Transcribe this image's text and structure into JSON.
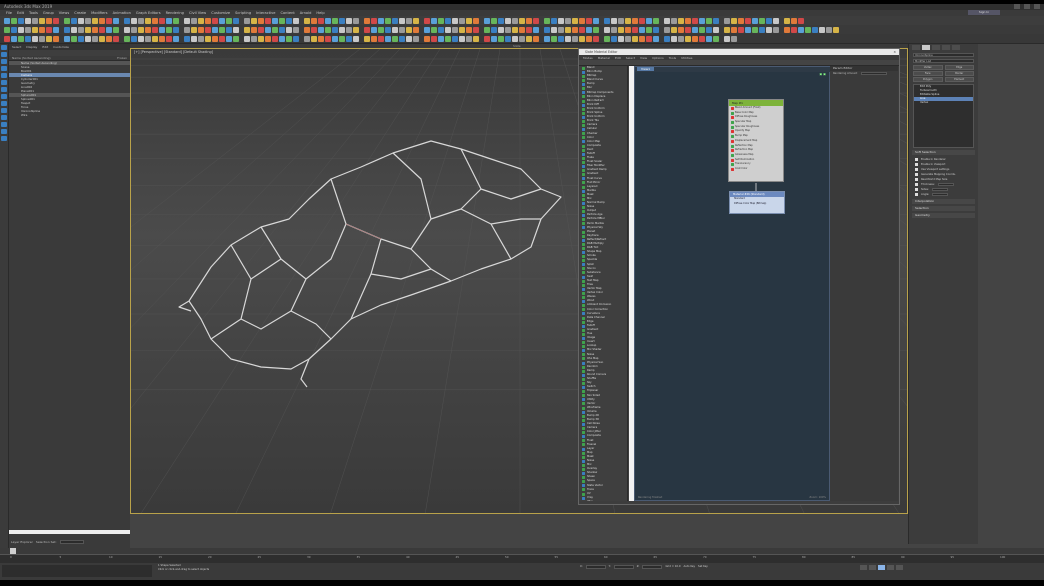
{
  "app": {
    "title": "Autodesk 3ds Max 2019",
    "signin_label": "Sign In"
  },
  "menu": [
    "File",
    "Edit",
    "Tools",
    "Group",
    "Views",
    "Create",
    "Modifiers",
    "Animation",
    "Graph Editors",
    "Rendering",
    "Civil View",
    "Customize",
    "Scripting",
    "Interactive",
    "Content",
    "Arnold",
    "Help"
  ],
  "explorer": {
    "tabs": [
      "Select",
      "Display",
      "Edit",
      "Customize"
    ],
    "columns": {
      "name": "Name (Sorted Ascending)",
      "frozen": "Frozen",
      "render": "Re"
    },
    "rows": [
      {
        "label": "Name (Sorted Ascending)",
        "style": "alt"
      },
      {
        "label": "Scene",
        "style": ""
      },
      {
        "label": "Box001",
        "style": ""
      },
      {
        "label": "Camera",
        "style": "sel"
      },
      {
        "label": "Cylinder001",
        "style": ""
      },
      {
        "label": "Geometry",
        "style": ""
      },
      {
        "label": "Line002",
        "style": ""
      },
      {
        "label": "Plane001",
        "style": ""
      },
      {
        "label": "Sphere001",
        "style": "alt"
      },
      {
        "label": "Spline001",
        "style": ""
      },
      {
        "label": "Teapot",
        "style": ""
      },
      {
        "label": "Torus",
        "style": ""
      },
      {
        "label": "VoronoiSpline",
        "style": ""
      },
      {
        "label": "Wire",
        "style": ""
      }
    ],
    "layer_label": "Layer Explorer",
    "selection_label": "Selection Set:"
  },
  "viewport": {
    "label": "[+] [Perspective] [Standard] [Default Shading]",
    "top_label": "Slate"
  },
  "slate": {
    "title": "Slate Material Editor",
    "menu": [
      "Modes",
      "Material",
      "Edit",
      "Select",
      "View",
      "Options",
      "Tools",
      "Utilities"
    ],
    "view_tab": "View1",
    "materials": [
      {
        "label": "Blend",
        "c": "#3fa34d"
      },
      {
        "label": "Blinn Bump",
        "c": "#3a7fc1"
      },
      {
        "label": "Bitmap",
        "c": "#3fa34d"
      },
      {
        "label": "Blend Curve",
        "c": "#3fa34d"
      },
      {
        "label": "Bump",
        "c": "#3a7fc1"
      },
      {
        "label": "Blur",
        "c": "#3fa34d"
      },
      {
        "label": "Bitmap Components",
        "c": "#3a7fc1"
      },
      {
        "label": "Blinn Displace",
        "c": "#3fa34d"
      },
      {
        "label": "Blinn Refract",
        "c": "#3fa34d"
      },
      {
        "label": "Brick Diff",
        "c": "#3a7fc1"
      },
      {
        "label": "Brick Uniform",
        "c": "#3fa34d"
      },
      {
        "label": "Brick Spline",
        "c": "#3fa34d"
      },
      {
        "label": "Brick Uniform",
        "c": "#3a7fc1"
      },
      {
        "label": "Brick Tile",
        "c": "#3fa34d"
      },
      {
        "label": "Camera",
        "c": "#3fa34d"
      },
      {
        "label": "Cellular",
        "c": "#3a7fc1"
      },
      {
        "label": "Checker",
        "c": "#3fa34d"
      },
      {
        "label": "Color",
        "c": "#3fa34d"
      },
      {
        "label": "Color Map",
        "c": "#3a7fc1"
      },
      {
        "label": "Composite",
        "c": "#3fa34d"
      },
      {
        "label": "Dent",
        "c": "#3fa34d"
      },
      {
        "label": "Falloff",
        "c": "#3a7fc1"
      },
      {
        "label": "Flake",
        "c": "#3fa34d"
      },
      {
        "label": "Float Scalar",
        "c": "#3fa34d"
      },
      {
        "label": "Fiber Modifier",
        "c": "#3a7fc1"
      },
      {
        "label": "Gradient Ramp",
        "c": "#3fa34d"
      },
      {
        "label": "Gradient",
        "c": "#3fa34d"
      },
      {
        "label": "Float Curve",
        "c": "#3a7fc1"
      },
      {
        "label": "Flat Mirror",
        "c": "#3fa34d"
      },
      {
        "label": "Layered",
        "c": "#3fa34d"
      },
      {
        "label": "Marble",
        "c": "#3a7fc1"
      },
      {
        "label": "Mask",
        "c": "#3fa34d"
      },
      {
        "label": "Mix",
        "c": "#3fa34d"
      },
      {
        "label": "Normal Bump",
        "c": "#3a7fc1"
      },
      {
        "label": "Noise",
        "c": "#3fa34d"
      },
      {
        "label": "Output",
        "c": "#3fa34d"
      },
      {
        "label": "Particle Age",
        "c": "#3a7fc1"
      },
      {
        "label": "Particle MBlur",
        "c": "#3fa34d"
      },
      {
        "label": "Perlin Marble",
        "c": "#3fa34d"
      },
      {
        "label": "Physical Sky",
        "c": "#3a7fc1"
      },
      {
        "label": "Planet",
        "c": "#3fa34d"
      },
      {
        "label": "Raytrace",
        "c": "#3fa34d"
      },
      {
        "label": "Reflect/Refract",
        "c": "#3a7fc1"
      },
      {
        "label": "RGB Multiply",
        "c": "#3fa34d"
      },
      {
        "label": "RGB Tint",
        "c": "#3fa34d"
      },
      {
        "label": "Shape Map",
        "c": "#3a7fc1"
      },
      {
        "label": "Smoke",
        "c": "#3fa34d"
      },
      {
        "label": "Speckle",
        "c": "#3fa34d"
      },
      {
        "label": "Splat",
        "c": "#3a7fc1"
      },
      {
        "label": "Stucco",
        "c": "#3fa34d"
      },
      {
        "label": "Substance",
        "c": "#3fa34d"
      },
      {
        "label": "Swirl",
        "c": "#3a7fc1"
      },
      {
        "label": "Text Map",
        "c": "#3fa34d"
      },
      {
        "label": "Tiles",
        "c": "#3fa34d"
      },
      {
        "label": "Vector Map",
        "c": "#3a7fc1"
      },
      {
        "label": "Vertex Color",
        "c": "#3fa34d"
      },
      {
        "label": "Waves",
        "c": "#3fa34d"
      },
      {
        "label": "Wood",
        "c": "#3a7fc1"
      },
      {
        "label": "Ambient Occlusion",
        "c": "#3fa34d"
      },
      {
        "label": "Color Correction",
        "c": "#3fa34d"
      },
      {
        "label": "Curvature",
        "c": "#3a7fc1"
      },
      {
        "label": "Data Channel",
        "c": "#3fa34d"
      },
      {
        "label": "Edge",
        "c": "#3fa34d"
      },
      {
        "label": "Falloff",
        "c": "#3a7fc1"
      },
      {
        "label": "Gradient",
        "c": "#3fa34d"
      },
      {
        "label": "Hue",
        "c": "#3fa34d"
      },
      {
        "label": "Image",
        "c": "#3a7fc1"
      },
      {
        "label": "Invert",
        "c": "#3fa34d"
      },
      {
        "label": "Lookup",
        "c": "#3fa34d"
      },
      {
        "label": "Mix Shader",
        "c": "#3a7fc1"
      },
      {
        "label": "Noise",
        "c": "#3fa34d"
      },
      {
        "label": "OSL Map",
        "c": "#3fa34d"
      },
      {
        "label": "Physical Sun",
        "c": "#3a7fc1"
      },
      {
        "label": "Random",
        "c": "#3fa34d"
      },
      {
        "label": "Ramp",
        "c": "#3fa34d"
      },
      {
        "label": "Round Corners",
        "c": "#3a7fc1"
      },
      {
        "label": "Shuffle",
        "c": "#3fa34d"
      },
      {
        "label": "Sky",
        "c": "#3fa34d"
      },
      {
        "label": "Switch",
        "c": "#3a7fc1"
      },
      {
        "label": "Triplanar",
        "c": "#3fa34d"
      },
      {
        "label": "Two Sided",
        "c": "#3fa34d"
      },
      {
        "label": "Utility",
        "c": "#3a7fc1"
      },
      {
        "label": "Vector",
        "c": "#3fa34d"
      },
      {
        "label": "Wireframe",
        "c": "#3fa34d"
      },
      {
        "label": "Volume",
        "c": "#3a7fc1"
      },
      {
        "label": "Bump 2D",
        "c": "#3fa34d"
      },
      {
        "label": "Bump 3D",
        "c": "#3fa34d"
      },
      {
        "label": "Cell Noise",
        "c": "#3a7fc1"
      },
      {
        "label": "Camera",
        "c": "#3fa34d"
      },
      {
        "label": "Color Jitter",
        "c": "#3fa34d"
      },
      {
        "label": "Composite",
        "c": "#3a7fc1"
      },
      {
        "label": "Float",
        "c": "#3fa34d"
      },
      {
        "label": "Fresnel",
        "c": "#3fa34d"
      },
      {
        "label": "Layer",
        "c": "#3a7fc1"
      },
      {
        "label": "Map",
        "c": "#3fa34d"
      },
      {
        "label": "Mask",
        "c": "#3fa34d"
      },
      {
        "label": "Noise",
        "c": "#3a7fc1"
      },
      {
        "label": "Mix",
        "c": "#3fa34d"
      },
      {
        "label": "Overlay",
        "c": "#3fa34d"
      },
      {
        "label": "Shadow",
        "c": "#3a7fc1"
      },
      {
        "label": "Sheen",
        "c": "#3fa34d"
      },
      {
        "label": "Space",
        "c": "#3fa34d"
      },
      {
        "label": "State Vector",
        "c": "#3a7fc1"
      },
      {
        "label": "Trace",
        "c": "#3fa34d"
      },
      {
        "label": "UV",
        "c": "#3fa34d"
      },
      {
        "label": "Vray",
        "c": "#3a7fc1"
      },
      {
        "label": "Wire",
        "c": "#3fa34d"
      }
    ],
    "node": {
      "title": "Map #1",
      "slots": [
        {
          "label": "Blend Amount (Float)",
          "c": "#d33"
        },
        {
          "label": "Base Color Map",
          "c": "#3fa34d"
        },
        {
          "label": "Diffuse Roughness",
          "c": "#d33"
        },
        {
          "label": "Specular Map",
          "c": "#3fa34d"
        },
        {
          "label": "Specular Roughness",
          "c": "#3fa34d"
        },
        {
          "label": "Opacity Map",
          "c": "#d33"
        },
        {
          "label": "Bump Map",
          "c": "#3fa34d"
        },
        {
          "label": "Displacement Map",
          "c": "#d33"
        },
        {
          "label": "Reflection Map",
          "c": "#3fa34d"
        },
        {
          "label": "Refraction Map",
          "c": "#d33"
        },
        {
          "label": "Glossiness Map",
          "c": "#3fa34d"
        },
        {
          "label": "Self-Illumination",
          "c": "#d33"
        },
        {
          "label": "Translucency",
          "c": "#3fa34d"
        },
        {
          "label": "Coat Color",
          "c": "#d33"
        }
      ]
    },
    "node2": {
      "title": "Material #26 (Standard)",
      "lines": [
        "Standard",
        "Diffuse Color Map (Bitmap)"
      ]
    },
    "navigator_title": "Param Editor",
    "navigator_rows": [
      {
        "label": "Rendering Amount"
      }
    ],
    "status_left": "Rendering finished",
    "status_right": "Zoom: 100%"
  },
  "cmdpanel": {
    "name_field": "VoronoiSpline",
    "modifier_list": "Modifier List",
    "buttons": [
      [
        "Vertex",
        "Edge"
      ],
      [
        "Face",
        "Border"
      ],
      [
        "Polygon",
        "Element"
      ]
    ],
    "stack": [
      {
        "label": "Edit Poly",
        "sel": ""
      },
      {
        "label": "Turbosmooth",
        "sel": ""
      },
      {
        "label": "Editable Spline",
        "sel": ""
      },
      {
        "label": "Line",
        "sel": "sel"
      },
      {
        "label": "Vertex",
        "sel": ""
      }
    ],
    "rollouts": [
      "Soft Selection",
      "Interpolation",
      "Selection",
      "Geometry"
    ],
    "props": [
      {
        "label": "Enable In Renderer"
      },
      {
        "label": "Enable In Viewport"
      },
      {
        "label": "Use Viewport settings"
      },
      {
        "label": "Generate Mapping Coords."
      },
      {
        "label": "Real-World Map Size"
      },
      {
        "label": "Thickness:"
      },
      {
        "label": "Sides:"
      },
      {
        "label": "Angle:"
      }
    ]
  },
  "timeline": {
    "frame_label": "0 / 100",
    "ticks": [
      "0",
      "5",
      "10",
      "15",
      "20",
      "25",
      "30",
      "35",
      "40",
      "45",
      "50",
      "55",
      "60",
      "65",
      "70",
      "75",
      "80",
      "85",
      "90",
      "95",
      "100"
    ]
  },
  "status": {
    "messages": [
      "1 Shape Selected",
      "Click or click-and-drag to select objects"
    ],
    "x_label": "X:",
    "y_label": "Y:",
    "z_label": "Z:",
    "grid_label": "Grid = 10.0",
    "autokey_label": "Auto Key",
    "setkey_label": "Set Key"
  }
}
